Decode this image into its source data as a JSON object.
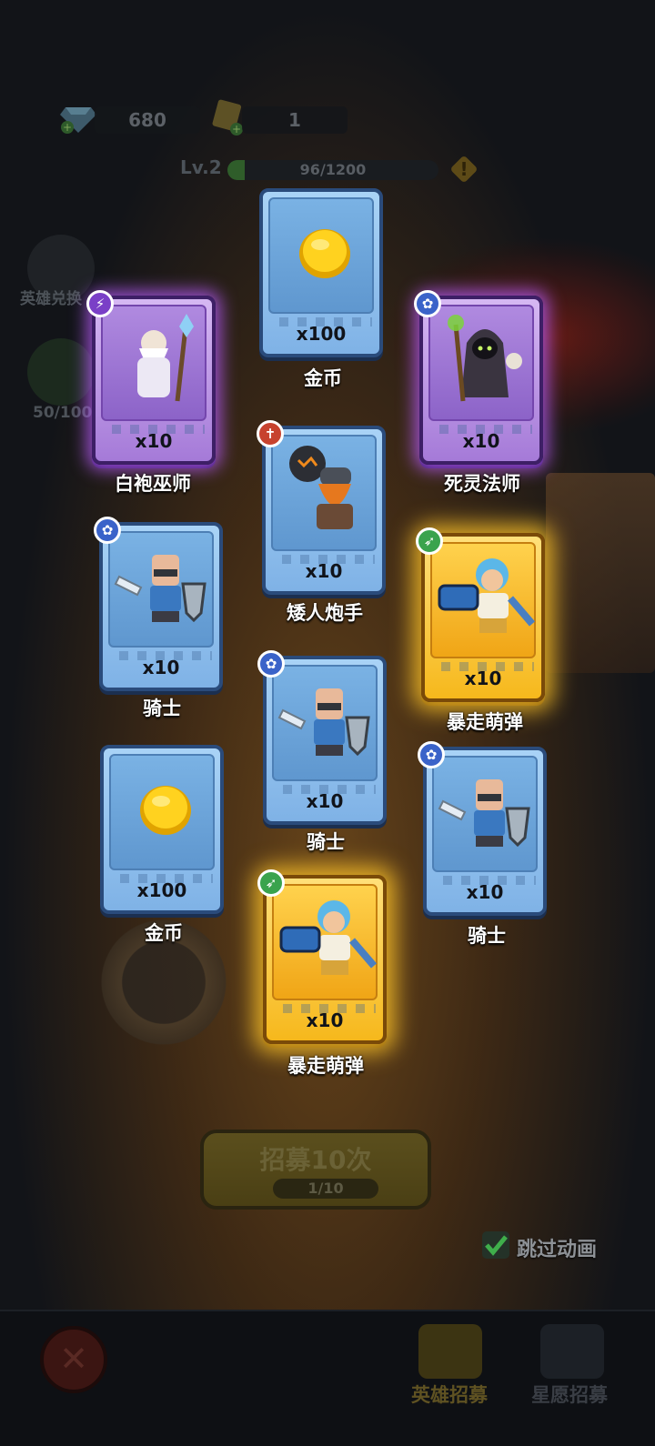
{
  "currency": {
    "gems": "680",
    "tickets": "1"
  },
  "level": {
    "label": "Lv.2",
    "xp_text": "96/1200",
    "xp_fraction": 0.08
  },
  "side": {
    "hero_exchange_label": "英雄兑换",
    "star_progress_label": "50/100"
  },
  "cards": [
    {
      "name": "金币",
      "qty": "x100",
      "rarity": "blue",
      "art": "gold-coin"
    },
    {
      "name": "白袍巫师",
      "qty": "x10",
      "rarity": "purple",
      "art": "white-wizard",
      "badge": "purple"
    },
    {
      "name": "死灵法师",
      "qty": "x10",
      "rarity": "purple",
      "art": "necromancer",
      "badge": "blue"
    },
    {
      "name": "矮人炮手",
      "qty": "x10",
      "rarity": "blue",
      "art": "dwarf-gunner",
      "badge": "red"
    },
    {
      "name": "骑士",
      "qty": "x10",
      "rarity": "blue",
      "art": "knight",
      "badge": "blue"
    },
    {
      "name": "暴走萌弹",
      "qty": "x10",
      "rarity": "gold",
      "art": "berserk-gunner",
      "badge": "green"
    },
    {
      "name": "骑士",
      "qty": "x10",
      "rarity": "blue",
      "art": "knight",
      "badge": "blue"
    },
    {
      "name": "金币",
      "qty": "x100",
      "rarity": "blue",
      "art": "gold-coin"
    },
    {
      "name": "骑士",
      "qty": "x10",
      "rarity": "blue",
      "art": "knight",
      "badge": "blue"
    },
    {
      "name": "暴走萌弹",
      "qty": "x10",
      "rarity": "gold",
      "art": "berserk-gunner",
      "badge": "green"
    }
  ],
  "recruit": {
    "label": "招募10次",
    "count": "1/10"
  },
  "skip_animation": {
    "label": "跳过动画",
    "checked": true
  },
  "tabs": {
    "hero_recruit": "英雄招募",
    "star_wish_recruit": "星愿招募"
  },
  "colors": {
    "gold_glow": "#ffc428",
    "purple_glow": "#ba5cff",
    "card_blue": "#7fb2e6"
  }
}
